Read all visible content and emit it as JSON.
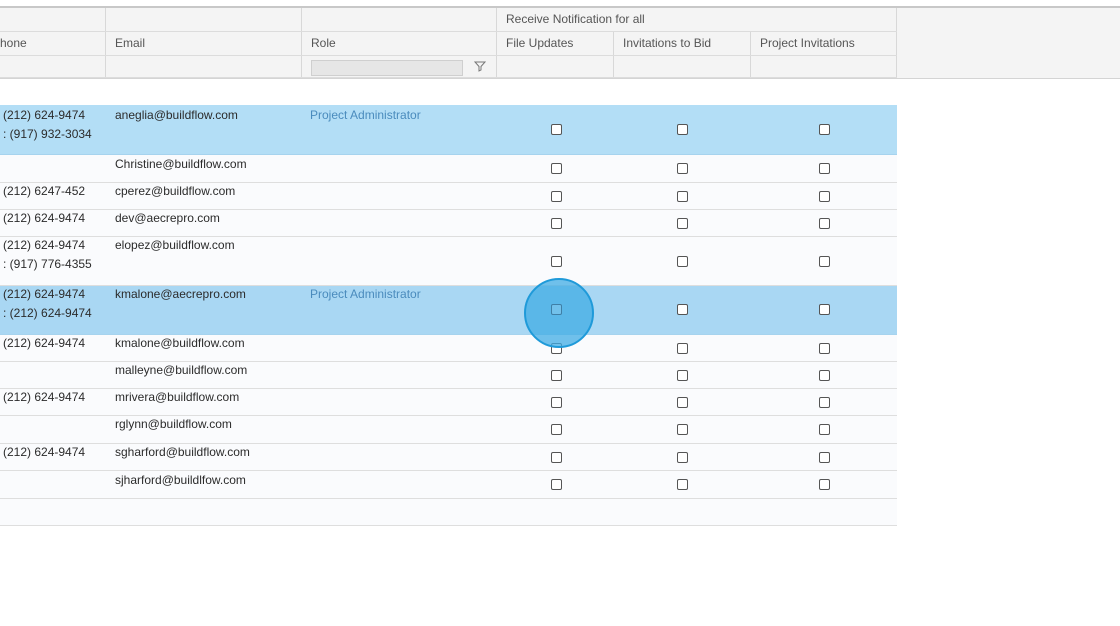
{
  "header": {
    "group_label": "Receive Notification for all",
    "columns": {
      "phone": "hone",
      "email": "Email",
      "role": "Role",
      "file_updates": "File Updates",
      "invitations_to_bid": "Invitations to Bid",
      "project_invitations": "Project Invitations"
    }
  },
  "rows": [
    {
      "phone": "(212) 624-9474",
      "phone2": ": (917) 932-3034",
      "email": "aneglia@buildflow.com",
      "role": "Project Administrator",
      "selected": true
    },
    {
      "phone": "",
      "phone2": "",
      "email": "Christine@buildflow.com",
      "role": "",
      "selected": false
    },
    {
      "phone": "(212) 6247-452",
      "phone2": "",
      "email": "cperez@buildflow.com",
      "role": "",
      "selected": false
    },
    {
      "phone": "(212) 624-9474",
      "phone2": "",
      "email": "dev@aecrepro.com",
      "role": "",
      "selected": false
    },
    {
      "phone": "(212) 624-9474",
      "phone2": ": (917) 776-4355",
      "email": "elopez@buildflow.com",
      "role": "",
      "selected": false
    },
    {
      "phone": "(212) 624-9474",
      "phone2": ": (212) 624-9474",
      "email": "kmalone@aecrepro.com",
      "role": "Project Administrator",
      "selected": true
    },
    {
      "phone": "(212) 624-9474",
      "phone2": "",
      "email": "kmalone@buildflow.com",
      "role": "",
      "selected": false
    },
    {
      "phone": "",
      "phone2": "",
      "email": "malleyne@buildflow.com",
      "role": "",
      "selected": false
    },
    {
      "phone": "(212) 624-9474",
      "phone2": "",
      "email": "mrivera@buildflow.com",
      "role": "",
      "selected": false
    },
    {
      "phone": "",
      "phone2": "",
      "email": "rglynn@buildflow.com",
      "role": "",
      "selected": false
    },
    {
      "phone": "(212) 624-9474",
      "phone2": "",
      "email": "sgharford@buildflow.com",
      "role": "",
      "selected": false
    },
    {
      "phone": "",
      "phone2": "",
      "email": "sjharford@buildlfow.com",
      "role": "",
      "selected": false
    }
  ],
  "icons": {
    "filter": "filter-icon"
  },
  "colors": {
    "selected_row": "#b3def6",
    "role_link": "#4a8bbd",
    "highlight": "#1f9ad9"
  }
}
